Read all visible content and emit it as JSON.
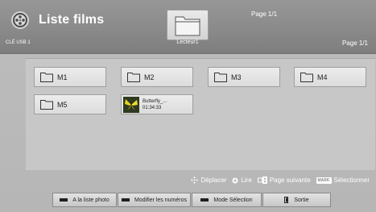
{
  "header": {
    "title": "Liste films",
    "source": "CLÉ USB 1",
    "page_top": "Page 1/1",
    "page_right": "Page 1/1",
    "drive_label": "Lecteur1"
  },
  "items": [
    {
      "label": "M1"
    },
    {
      "label": "M2"
    },
    {
      "label": "M3"
    },
    {
      "label": "M4"
    },
    {
      "label": "M5"
    }
  ],
  "file": {
    "name": "Butterfly_...",
    "duration": "01:34:33"
  },
  "hints": {
    "move": "Déplacer",
    "play": "Lire",
    "next_page": "Page suivante",
    "mark_chip": "MARK",
    "select": "Sélectionner"
  },
  "buttons": {
    "photo": "A la liste photo",
    "edit_numbers": "Modifier les numéros",
    "select_mode": "Mode Sélection",
    "exit": "Sortie"
  }
}
